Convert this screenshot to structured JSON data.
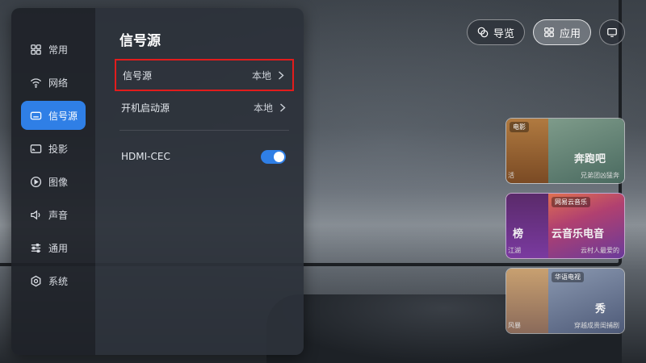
{
  "topbar": {
    "guide_label": "导览",
    "apps_label": "应用"
  },
  "sidebar": {
    "items": [
      {
        "label": "常用",
        "icon": "grid-icon"
      },
      {
        "label": "网络",
        "icon": "wifi-icon"
      },
      {
        "label": "信号源",
        "icon": "input-source-icon",
        "active": true
      },
      {
        "label": "投影",
        "icon": "cast-icon"
      },
      {
        "label": "图像",
        "icon": "play-circle-icon"
      },
      {
        "label": "声音",
        "icon": "speaker-icon"
      },
      {
        "label": "通用",
        "icon": "sliders-icon"
      },
      {
        "label": "系统",
        "icon": "gear-icon"
      }
    ]
  },
  "content": {
    "title": "信号源",
    "rows": [
      {
        "label": "信号源",
        "value": "本地"
      },
      {
        "label": "开机启动源",
        "value": "本地"
      }
    ],
    "cec": {
      "label": "HDMI-CEC",
      "enabled": true
    }
  },
  "cards": [
    {
      "tag": "电影",
      "title": "奔跑吧",
      "sub": "兄弟团凶猛奔",
      "lsub": "活"
    },
    {
      "tag": "网易云音乐",
      "title": "云音乐电音",
      "sub": "云村人最爱的",
      "lsub": "江湖",
      "ltitle": "榜"
    },
    {
      "tag": "华语电视",
      "title": "秀",
      "sub": "穿越成贵闺捕剧",
      "lsub": "风暴"
    }
  ],
  "colors": {
    "accent": "#2f7fe6",
    "highlight_border": "#e21c1c"
  }
}
